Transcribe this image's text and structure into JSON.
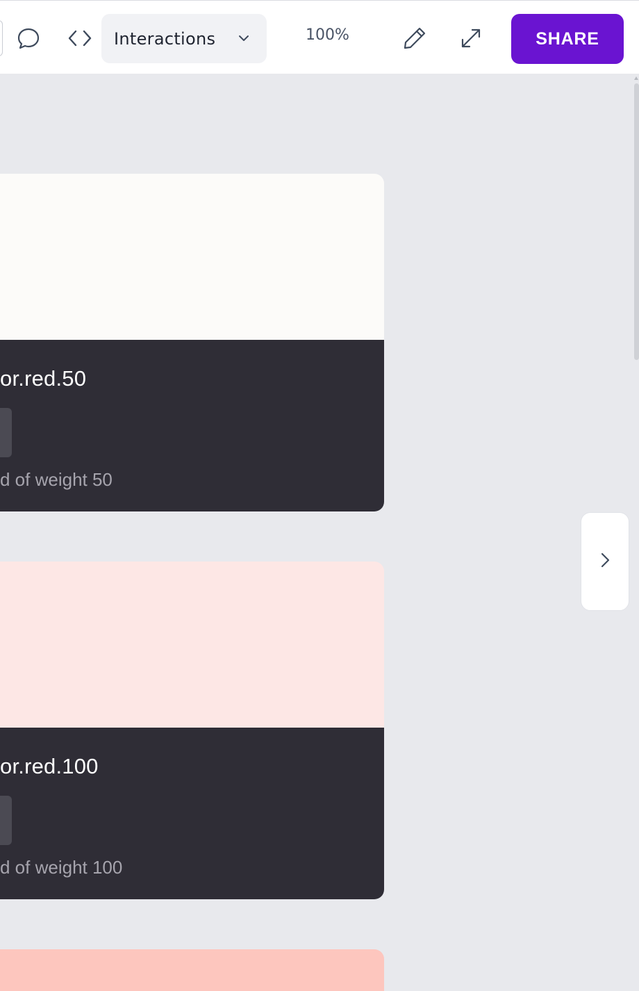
{
  "toolbar": {
    "comment_icon": "comment-icon",
    "code_icon": "code-icon",
    "mode_dropdown": {
      "label": "Interactions",
      "icon": "chevron-down-icon"
    },
    "zoom": "100%",
    "edit_icon": "pencil-icon",
    "fullscreen_icon": "expand-icon",
    "share_label": "SHARE"
  },
  "colors": {
    "accent": "#6a14d1",
    "canvas": "#e8e9ed",
    "card_info_bg": "#2f2d36"
  },
  "cards": [
    {
      "name": "or.red.50",
      "description": "d of weight 50",
      "swatch_color": "#fcfbf9"
    },
    {
      "name": "or.red.100",
      "description": "d of weight 100",
      "swatch_color": "#fde7e5"
    },
    {
      "swatch_color": "#fdc6be"
    }
  ],
  "next_icon": "chevron-right-icon"
}
